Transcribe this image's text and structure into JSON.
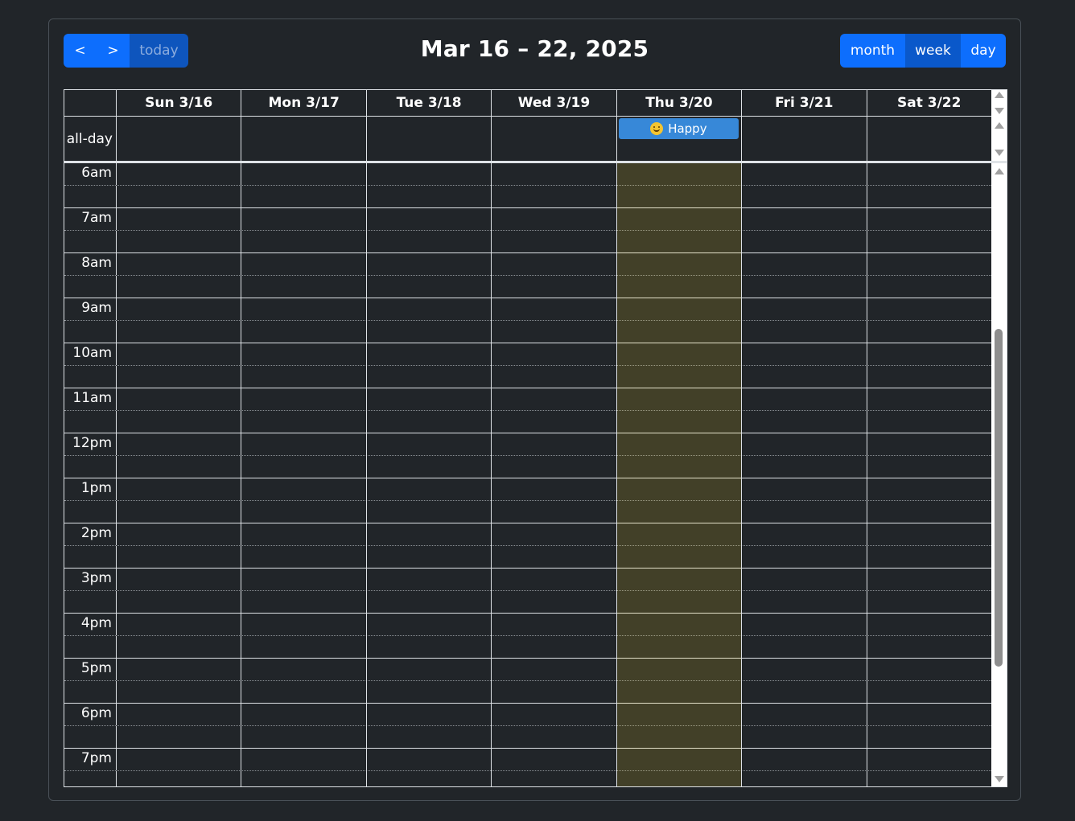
{
  "toolbar": {
    "prev_label": "<",
    "next_label": ">",
    "today_label": "today",
    "title": "Mar 16 – 22, 2025",
    "views": [
      {
        "label": "month"
      },
      {
        "label": "week"
      },
      {
        "label": "day"
      }
    ]
  },
  "days": [
    {
      "label": "Sun 3/16"
    },
    {
      "label": "Mon 3/17"
    },
    {
      "label": "Tue 3/18"
    },
    {
      "label": "Wed 3/19"
    },
    {
      "label": "Thu 3/20"
    },
    {
      "label": "Fri 3/21"
    },
    {
      "label": "Sat 3/22"
    }
  ],
  "all_day_label": "all-day",
  "event": {
    "title": "Happy",
    "icon": "smiling-face-icon",
    "day": "Thu 3/20",
    "color": "#3788d8"
  },
  "hours": [
    "6am",
    "7am",
    "8am",
    "9am",
    "10am",
    "11am",
    "12pm",
    "1pm",
    "2pm",
    "3pm",
    "4pm",
    "5pm",
    "6pm",
    "7pm"
  ],
  "colors": {
    "background": "#212529",
    "primary": "#0d6efd",
    "today_highlight": "#43432b",
    "event": "#3788d8"
  }
}
